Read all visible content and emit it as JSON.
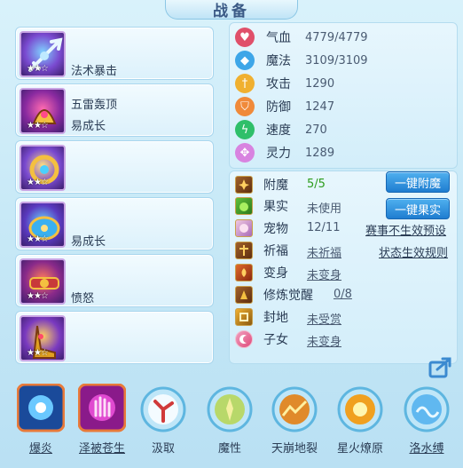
{
  "header": {
    "title": "战备"
  },
  "equipment": [
    {
      "stars": "★★☆",
      "text": "法术暴击",
      "color": "#6ec3ff"
    },
    {
      "stars": "★★☆",
      "text_top": "五雷轰顶",
      "text_bottom": "易成长",
      "color": "#d64a8c"
    },
    {
      "stars": "★★☆",
      "text": "",
      "color": "#f0c040"
    },
    {
      "stars": "★★☆",
      "text": "易成长",
      "color": "#4cc0f0"
    },
    {
      "stars": "★★☆",
      "text": "愤怒",
      "color": "#d04040"
    },
    {
      "stars": "★★☆",
      "text": "",
      "color": "#e0b030"
    }
  ],
  "stats": [
    {
      "label": "气血",
      "value": "4779/4779",
      "icon": "heart-icon",
      "color": "#e0506a"
    },
    {
      "label": "魔法",
      "value": "3109/3109",
      "icon": "diamond-icon",
      "color": "#3ea6e8"
    },
    {
      "label": "攻击",
      "value": "1290",
      "icon": "sword-icon",
      "color": "#f0b030"
    },
    {
      "label": "防御",
      "value": "1247",
      "icon": "shield-icon",
      "color": "#f08a3a"
    },
    {
      "label": "速度",
      "value": "270",
      "icon": "lightning-icon",
      "color": "#2fbf6a"
    },
    {
      "label": "灵力",
      "value": "1289",
      "icon": "cross-icon",
      "color": "#d883e0"
    }
  ],
  "info": [
    {
      "label": "附魔",
      "value": "5/5"
    },
    {
      "label": "果实",
      "value": "未使用"
    },
    {
      "label": "宠物",
      "value": "12/11"
    },
    {
      "label": "祈福",
      "value": "未祈福"
    },
    {
      "label": "变身",
      "value": "未变身"
    },
    {
      "label": "修炼觉醒",
      "value": "0/8"
    },
    {
      "label": "封地",
      "value": "未受赏"
    },
    {
      "label": "子女",
      "value": "未变身"
    }
  ],
  "buttons": {
    "enchant": "一键附魔",
    "fruit": "一键果实",
    "preset": "赛事不生效预设",
    "rules": "状态生效规则"
  },
  "skills": [
    {
      "label": "爆炎",
      "color": "#3a7de8"
    },
    {
      "label": "泽被苍生",
      "color": "#c84ab8"
    },
    {
      "label": "汲取",
      "color": "#d0e8f8"
    },
    {
      "label": "魔性",
      "color": "#a8d060"
    },
    {
      "label": "天崩地裂",
      "color": "#e08a2a"
    },
    {
      "label": "星火燎原",
      "color": "#f0a020"
    },
    {
      "label": "洛水缚",
      "color": "#60b8f0"
    }
  ]
}
